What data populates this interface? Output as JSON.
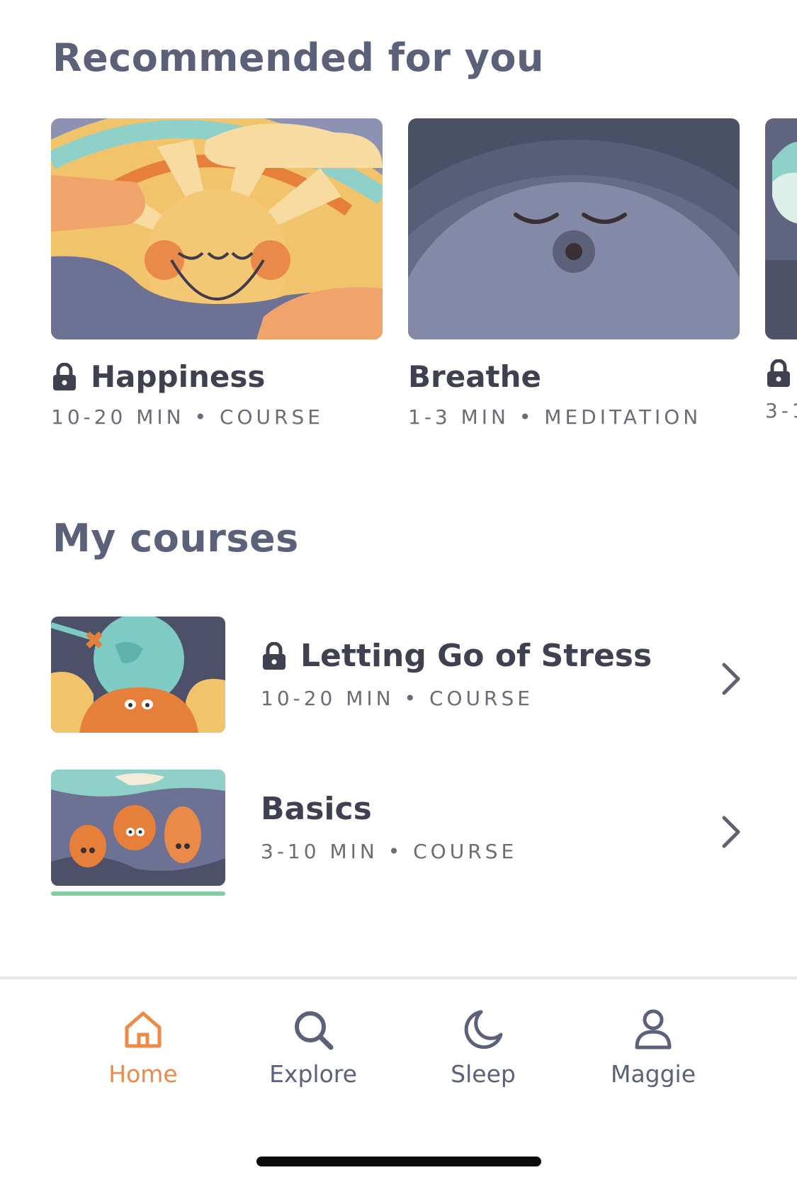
{
  "recommended": {
    "title": "Recommended for you",
    "cards": [
      {
        "title": "Happiness",
        "meta": "10-20 MIN • COURSE",
        "locked": true
      },
      {
        "title": "Breathe",
        "meta": "1-3 MIN • MEDITATION",
        "locked": false
      },
      {
        "title": "",
        "meta": "3-1",
        "locked": true
      }
    ]
  },
  "courses": {
    "title": "My courses",
    "items": [
      {
        "title": "Letting Go of Stress",
        "meta": "10-20 MIN • COURSE",
        "locked": true
      },
      {
        "title": "Basics",
        "meta": "3-10 MIN • COURSE",
        "locked": false
      }
    ]
  },
  "tabs": [
    {
      "label": "Home",
      "icon": "home-icon",
      "active": true
    },
    {
      "label": "Explore",
      "icon": "search-icon",
      "active": false
    },
    {
      "label": "Sleep",
      "icon": "moon-icon",
      "active": false
    },
    {
      "label": "Maggie",
      "icon": "profile-icon",
      "active": false
    }
  ],
  "colors": {
    "accent": "#ec8a47",
    "heading": "#5b6178",
    "progress": "#7fcfa2"
  }
}
